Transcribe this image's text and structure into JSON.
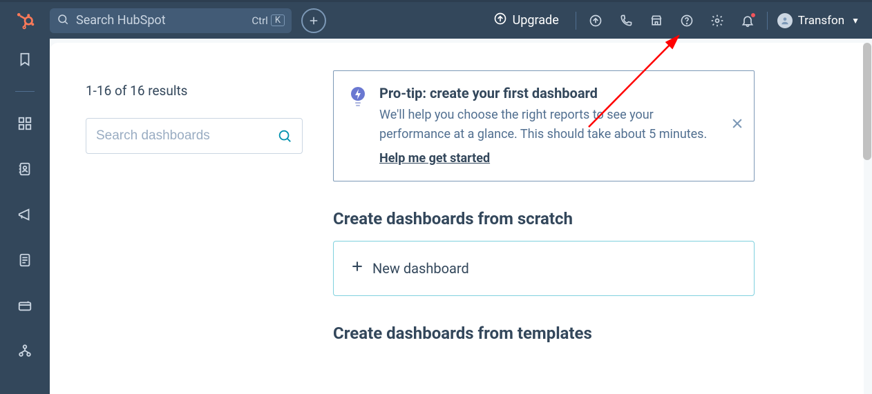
{
  "header": {
    "search_placeholder": "Search HubSpot",
    "search_kbd_ctrl": "Ctrl",
    "search_kbd_key": "K",
    "upgrade_label": "Upgrade",
    "account_name": "Transfon"
  },
  "sidebar": {
    "results_text": "1-16 of 16 results",
    "dash_search_placeholder": "Search dashboards"
  },
  "tip": {
    "title": "Pro-tip: create your first dashboard",
    "body": "We'll help you choose the right reports to see your performance at a glance. This should take about 5 minutes.",
    "link": "Help me get started"
  },
  "sections": {
    "scratch_heading": "Create dashboards from scratch",
    "new_dashboard_label": "New dashboard",
    "templates_heading": "Create dashboards from templates"
  }
}
